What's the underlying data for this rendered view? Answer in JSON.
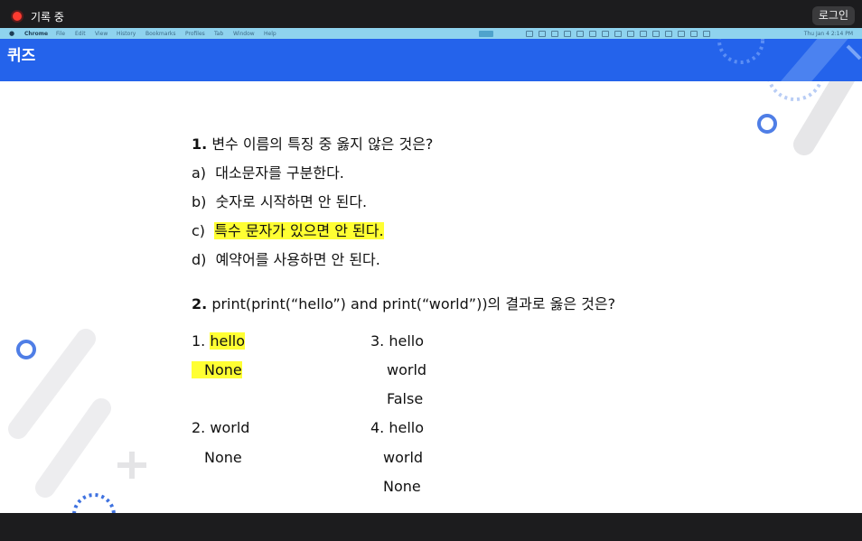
{
  "recording": {
    "label": "기록 중",
    "login_label": "로그인"
  },
  "menubar": {
    "app": "Chrome",
    "items": [
      "File",
      "Edit",
      "View",
      "History",
      "Bookmarks",
      "Profiles",
      "Tab",
      "Window",
      "Help"
    ],
    "clock": "Thu Jan 4  2:14 PM"
  },
  "header": {
    "title": "퀴즈"
  },
  "q1": {
    "number": "1.",
    "text": "변수 이름의  특징 중 옳지 않은 것은?",
    "options": [
      {
        "letter": "a)",
        "text": "대소문자를 구분한다."
      },
      {
        "letter": "b)",
        "text": "숫자로 시작하면 안 된다."
      },
      {
        "letter": "c)",
        "text": "특수 문자가 있으면 안 된다."
      },
      {
        "letter": "d)",
        "text": "예약어를 사용하면 안 된다."
      }
    ]
  },
  "q2": {
    "number": "2.",
    "text": "print(print(“hello”) and print(“world”))의 결과로 옳은 것은?",
    "choice1": {
      "label": "1.",
      "line1": "hello",
      "line2": "None"
    },
    "choice2": {
      "label": "2.",
      "line1": "world",
      "line2": "None"
    },
    "choice3": {
      "label": "3.",
      "line1": "hello",
      "line2": "world",
      "line3": "False"
    },
    "choice4": {
      "label": "4.",
      "line1": "hello",
      "line2": "world",
      "line3": "None"
    }
  }
}
